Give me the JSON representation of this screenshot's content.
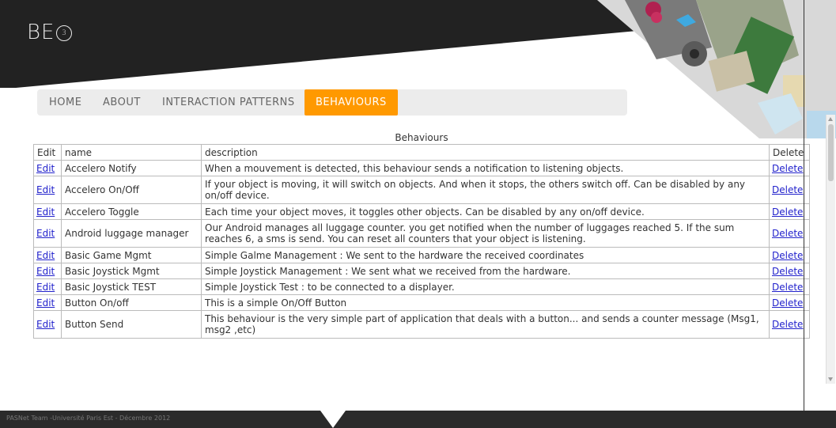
{
  "logo": {
    "text": "BE",
    "circle_text": "3"
  },
  "nav": {
    "items": [
      {
        "label": "Home",
        "active": false
      },
      {
        "label": "About",
        "active": false
      },
      {
        "label": "Interaction Patterns",
        "active": false
      },
      {
        "label": "Behaviours",
        "active": true
      }
    ]
  },
  "colors": {
    "accent": "#ff9900",
    "banner": "#222222",
    "link": "#2222cc",
    "footer": "#2b2b2b"
  },
  "table": {
    "caption": "Behaviours",
    "headers": {
      "edit": "Edit",
      "name": "name",
      "description": "description",
      "delete": "Delete"
    },
    "rows": [
      {
        "edit": "Edit",
        "name": "Accelero Notify",
        "description": "When a mouvement is detected, this behaviour sends a notification to listening objects.",
        "delete": "Delete"
      },
      {
        "edit": "Edit",
        "name": "Accelero On/Off",
        "description": "If your object is moving, it will switch on objects. And when it stops, the others switch off. Can be disabled by any on/off device.",
        "delete": "Delete"
      },
      {
        "edit": "Edit",
        "name": "Accelero Toggle",
        "description": "Each time your object moves, it toggles other objects. Can be disabled by any on/off device.",
        "delete": "Delete"
      },
      {
        "edit": "Edit",
        "name": "Android luggage manager",
        "description": "Our Android manages all luggage counter. you get notified when the number of luggages reached 5. If the sum reaches 6, a sms is send. You can reset all counters that your object is listening.",
        "delete": "Delete"
      },
      {
        "edit": "Edit",
        "name": "Basic Game Mgmt",
        "description": "Simple Galme Management : We sent to the hardware the received coordinates",
        "delete": "Delete"
      },
      {
        "edit": "Edit",
        "name": "Basic Joystick Mgmt",
        "description": "Simple Joystick Management : We sent what we received from the hardware.",
        "delete": "Delete"
      },
      {
        "edit": "Edit",
        "name": "Basic Joystick TEST",
        "description": "Simple Joystick Test : to be connected to a displayer.",
        "delete": "Delete"
      },
      {
        "edit": "Edit",
        "name": "Button On/off",
        "description": "This is a simple On/Off Button",
        "delete": "Delete"
      },
      {
        "edit": "Edit",
        "name": "Button Send",
        "description": "This behaviour is the very simple part of application that deals with a button... and sends a counter message (Msg1, msg2 ,etc)",
        "delete": "Delete"
      }
    ]
  },
  "footer": {
    "text": "PASNet Team -Université Paris Est - Décembre 2012"
  }
}
